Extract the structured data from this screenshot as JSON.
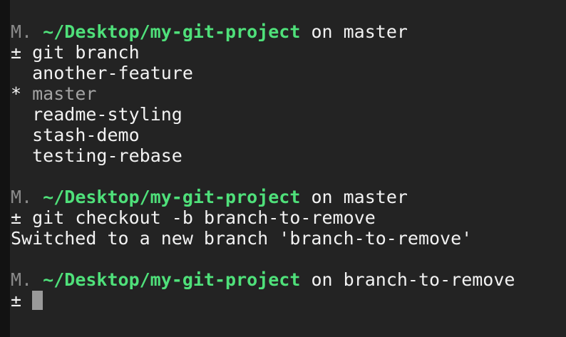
{
  "prompts": [
    {
      "user": "M.",
      "path": "~/Desktop/my-git-project",
      "on": " on ",
      "branch": "master",
      "symbol": "±",
      "command": "git branch"
    },
    {
      "user": "M.",
      "path": "~/Desktop/my-git-project",
      "on": " on ",
      "branch": "master",
      "symbol": "±",
      "command": "git checkout -b branch-to-remove"
    },
    {
      "user": "M.",
      "path": "~/Desktop/my-git-project",
      "on": " on ",
      "branch": "branch-to-remove",
      "symbol": "±",
      "command": ""
    }
  ],
  "branch_list": [
    {
      "marker": " ",
      "name": "another-feature"
    },
    {
      "marker": "*",
      "name": "master"
    },
    {
      "marker": " ",
      "name": "readme-styling"
    },
    {
      "marker": " ",
      "name": "stash-demo"
    },
    {
      "marker": " ",
      "name": "testing-rebase"
    }
  ],
  "checkout_output": "Switched to a new branch 'branch-to-remove'",
  "colors": {
    "background": "#232323",
    "text": "#f2f2f2",
    "path": "#4fe07a",
    "user": "#8a8a8a",
    "current_branch": "#a3a3a3",
    "cursor": "#9a9a9a"
  }
}
